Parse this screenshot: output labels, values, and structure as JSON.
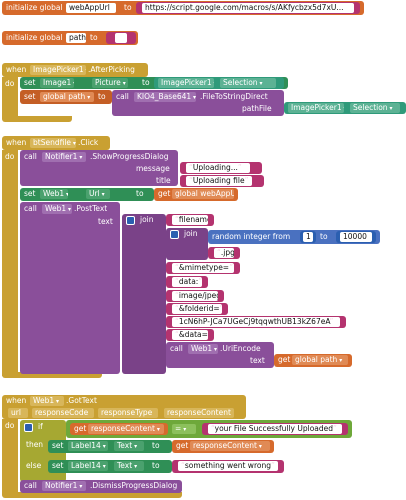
{
  "b1": {
    "label": "initialize global",
    "name": "webAppUrl",
    "to": "to",
    "value": "https://script.google.com/macros/s/AKfycbzx5d7xU..."
  },
  "b2": {
    "label": "initialize global",
    "name": "path",
    "to": "to",
    "value": ""
  },
  "b3": {
    "when": "when",
    "component": "ImagePicker1",
    "event": ".AfterPicking",
    "do": "do",
    "set": "set",
    "target": "Image1",
    "prop": "Picture",
    "to": "to",
    "src_comp": "ImagePicker1",
    "src_prop": "Selection",
    "set2_var": "global path",
    "call": "call",
    "call_comp": "KIO4_Base641",
    "call_method": ".FileToStringDirect",
    "param": "pathFile",
    "param_comp": "ImagePicker1",
    "param_prop": "Selection"
  },
  "b4": {
    "when": "when",
    "component": "btSendfile",
    "event": ".Click",
    "do": "do",
    "call": "call",
    "notifier": "Notifier1",
    "method": ".ShowProgressDialog",
    "message_label": "message",
    "message": "Uploading...",
    "title_label": "title",
    "title": "Uploading file",
    "set": "set",
    "web": "Web1",
    "prop": "Url",
    "to": "to",
    "get": "get",
    "get_var": "global webAppUrl",
    "call2": "call",
    "web2": "Web1",
    "method2": ".PostText",
    "text_label": "text",
    "join": "join",
    "j_filename": "filename=",
    "join2": "join",
    "random": "random integer from",
    "r_from": "1",
    "r_to_label": "to",
    "r_to": "10000",
    "ext": ".jpg",
    "j_mimetype": "&mimetype=",
    "j_data": "data:",
    "j_imagejpeg": "image/jpeg",
    "j_folderid": "&folderid=",
    "j_folder": "1cN6hP-JCa7UGeCj9tqqwthUB13kZ67eA",
    "j_dataeq": "&data=",
    "call3": "call",
    "web3": "Web1",
    "method3": ".UriEncode",
    "text_label2": "text",
    "get2": "get",
    "get2_var": "global path"
  },
  "b5": {
    "when": "when",
    "component": "Web1",
    "event": ".GotText",
    "p1": "url",
    "p2": "responseCode",
    "p3": "responseType",
    "p4": "responseContent",
    "do": "do",
    "if": "if",
    "get": "get",
    "get_var": "responseContent",
    "eq": "=",
    "eq_value": "your File Successfully Uploaded",
    "then": "then",
    "set": "set",
    "label": "Label14",
    "prop": "Text",
    "to": "to",
    "get2": "get",
    "get2_var": "responseContent",
    "else": "else",
    "set2": "set",
    "label2": "Label14",
    "prop2": "Text",
    "to2": "to",
    "else_text": "something went wrong",
    "call": "call",
    "notifier": "Notifier1",
    "method": ".DismissProgressDialog"
  }
}
